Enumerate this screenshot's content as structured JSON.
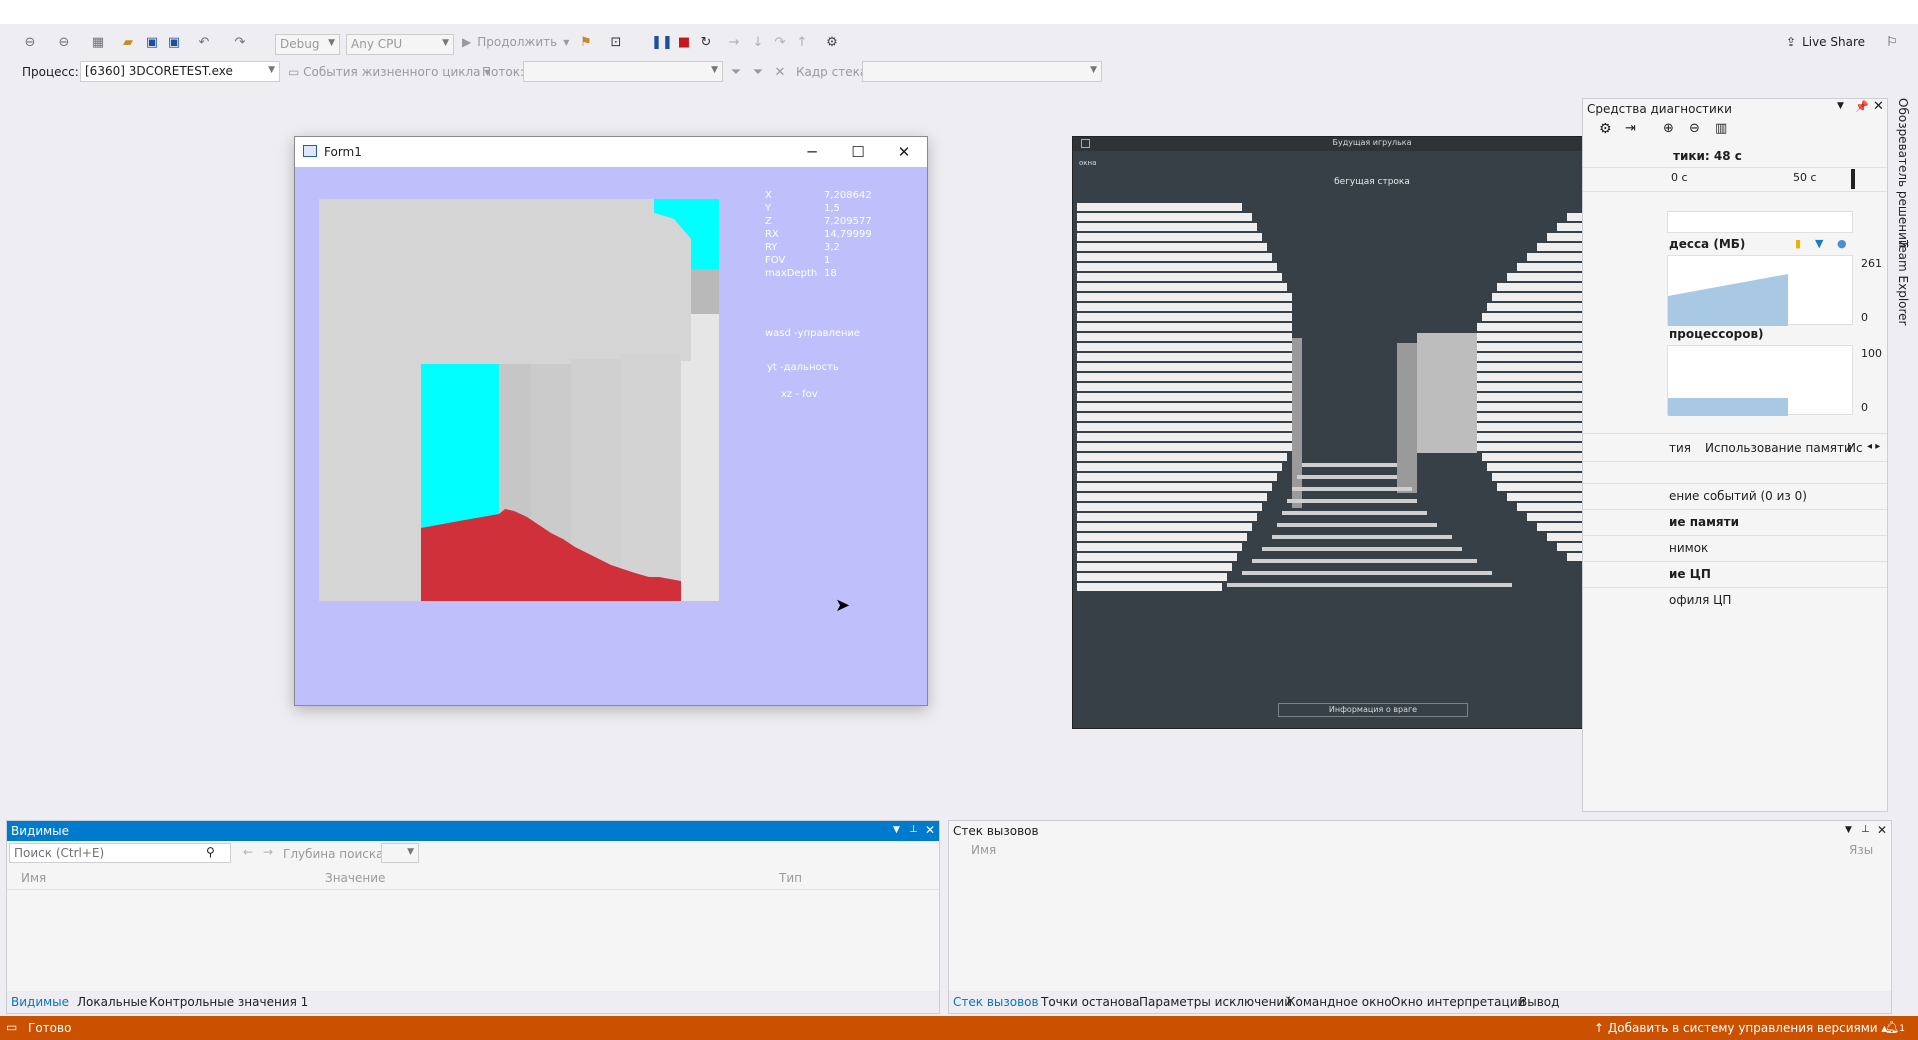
{
  "toolbar": {
    "config": "Debug",
    "platform": "Any CPU",
    "continue_label": "Продолжить",
    "live_share": "Live Share"
  },
  "debug_bar": {
    "process_label": "Процесс:",
    "process_value": "[6360] 3DCORETEST.exe",
    "lifecycle_label": "События жизненного цикла",
    "thread_label": "Поток:",
    "stack_frame_label": "Кадр стека:"
  },
  "form1": {
    "title": "Form1",
    "overlay": {
      "labels": [
        "X",
        "Y",
        "Z",
        "RX",
        "RY",
        "FOV",
        "maxDepth"
      ],
      "values": [
        "7,208642",
        "1,5",
        "7,209577",
        "14,79999",
        "3,2",
        "1",
        "18"
      ],
      "hint1": "wasd -управление",
      "hint2": "yt -дальность",
      "hint3": "xz - fov"
    },
    "colors": {
      "sky": "#bfc0fb",
      "cyan": "#00ffff",
      "red": "#d0303a",
      "grey": "#d4d4d4"
    }
  },
  "game_window": {
    "title": "Будущая игрулька",
    "menu": "окна",
    "header": "бегущая строка",
    "footer_button": "Информация о враге"
  },
  "diagnostics": {
    "title": "Средства диагностики",
    "session": "тики: 48 с",
    "timeline": [
      "0 с",
      "50 с"
    ],
    "memory_label": "десса (МБ)",
    "memory_max": "261",
    "memory_min": "0",
    "cpu_label": "процессоров)",
    "cpu_max": "100",
    "cpu_min": "0",
    "tabs": [
      "тия",
      "Использование памяти",
      "Ис"
    ],
    "rows": [
      "ение событий (0 из 0)",
      "ие памяти",
      "нимок",
      "ие ЦП",
      "офиля ЦП"
    ]
  },
  "side_tabs": [
    "Обозреватель решений",
    "Team Explorer"
  ],
  "locals": {
    "title": "Видимые",
    "search_placeholder": "Поиск (Ctrl+E)",
    "depth_label": "Глубина поиска:",
    "columns": [
      "Имя",
      "Значение",
      "Тип"
    ],
    "tabs": [
      "Видимые",
      "Локальные",
      "Контрольные значения 1"
    ]
  },
  "callstack": {
    "title": "Стек вызовов",
    "columns": [
      "Имя",
      "Язы"
    ],
    "tabs": [
      "Стек вызовов",
      "Точки останова",
      "Параметры исключений",
      "Командное окно",
      "Окно интерпретации",
      "Вывод"
    ]
  },
  "status": {
    "text": "Готово",
    "vcs": "Добавить в систему управления версиями",
    "notify_count": "1"
  }
}
